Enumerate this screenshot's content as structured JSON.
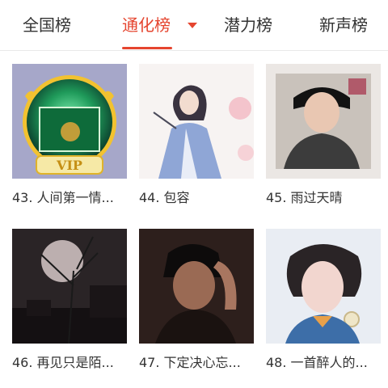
{
  "tabs": [
    {
      "label": "全国榜",
      "active": false
    },
    {
      "label": "通化榜",
      "active": true
    },
    {
      "label": "潜力榜",
      "active": false
    },
    {
      "label": "新声榜",
      "active": false
    }
  ],
  "accent_color": "#e5452f",
  "dropdown_icon": "caret-down-icon",
  "items": [
    {
      "caption": "43. 人间第一情...",
      "badge": "VIP"
    },
    {
      "caption": "44. 包容"
    },
    {
      "caption": "45. 雨过天晴"
    },
    {
      "caption": "46. 再见只是陌..."
    },
    {
      "caption": "47. 下定决心忘..."
    },
    {
      "caption": "48. 一首醉人的..."
    }
  ]
}
